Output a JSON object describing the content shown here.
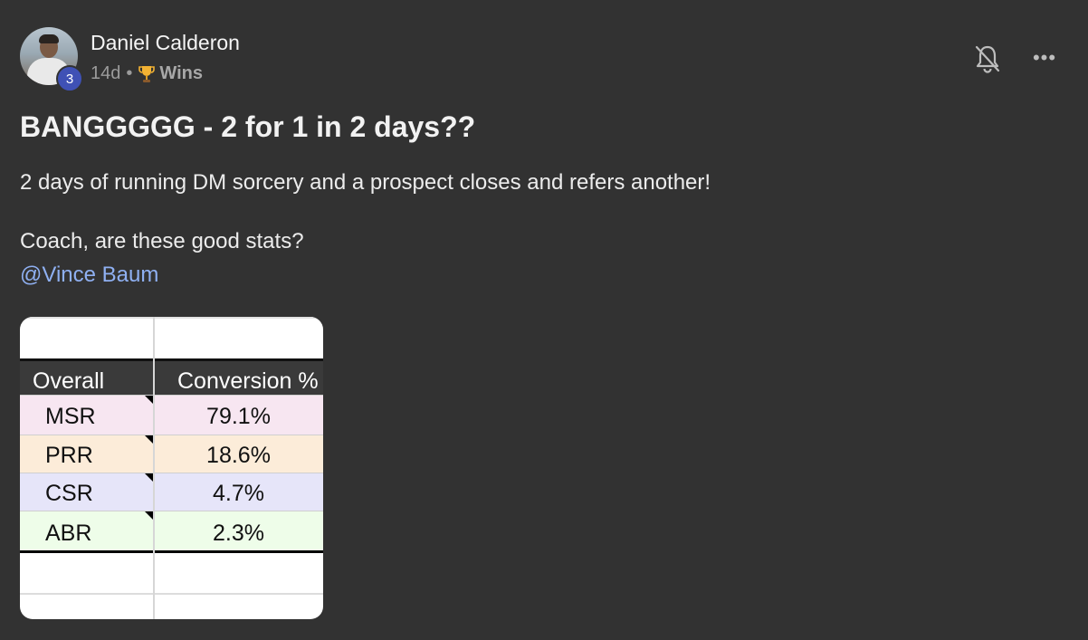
{
  "post": {
    "author": "Daniel Calderon",
    "level": "3",
    "time_ago": "14d",
    "separator": "•",
    "category": "Wins",
    "title": "BANGGGGG - 2 for 1 in 2 days??",
    "body_line1": "2 days of running DM sorcery and a prospect closes and refers another!",
    "body_line2": "Coach, are these good stats?",
    "mention": "@Vince Baum",
    "more_label": "•••"
  },
  "icons": {
    "avatar": "avatar-photo",
    "trophy": "trophy-icon",
    "bell": "bell-off-icon",
    "more": "more-icon"
  },
  "colors": {
    "background": "#323232",
    "level_badge": "#3f51b5",
    "mention": "#8fb0f2",
    "row_msr": "#f7e6f1",
    "row_prr": "#fcecd9",
    "row_csr": "#e6e5f9",
    "row_abr": "#eefde9"
  },
  "spreadsheet": {
    "headers": [
      "Overall",
      "Conversion %"
    ],
    "rows": [
      {
        "name": "MSR",
        "value": "79.1%"
      },
      {
        "name": "PRR",
        "value": "18.6%"
      },
      {
        "name": "CSR",
        "value": "4.7%"
      },
      {
        "name": "ABR",
        "value": "2.3%"
      }
    ]
  }
}
